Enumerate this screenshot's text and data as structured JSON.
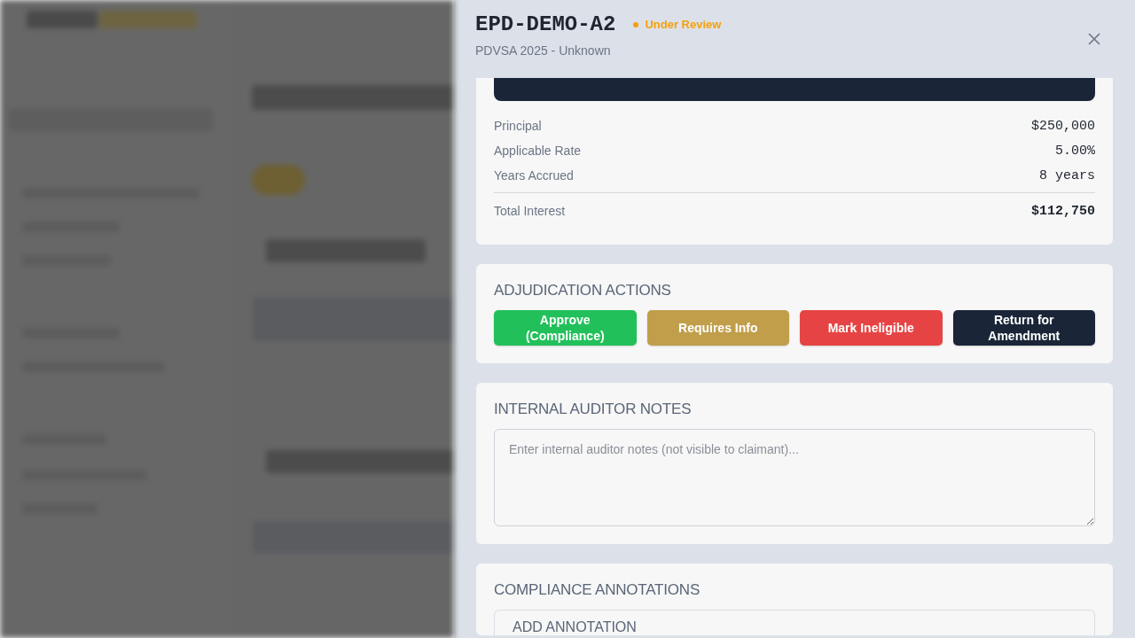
{
  "drawer": {
    "title": "EPD-DEMO-A2",
    "status": {
      "label": "Under Review",
      "kind": "review"
    },
    "subtitle": "PDVSA 2025 - Unknown"
  },
  "interest": {
    "rows": [
      {
        "label": "Principal",
        "value": "$250,000"
      },
      {
        "label": "Applicable Rate",
        "value": "5.00%"
      },
      {
        "label": "Years Accrued",
        "value": "8 years"
      }
    ],
    "total": {
      "label": "Total Interest",
      "value": "$112,750"
    }
  },
  "actions": {
    "heading": "ADJUDICATION ACTIONS",
    "buttons": [
      {
        "label": "Approve (Compliance)",
        "kind": "approve"
      },
      {
        "label": "Requires Info",
        "kind": "info"
      },
      {
        "label": "Mark Ineligible",
        "kind": "reject"
      },
      {
        "label": "Return for Amendment",
        "kind": "return"
      }
    ]
  },
  "notes": {
    "heading": "INTERNAL AUDITOR NOTES",
    "placeholder": "Enter internal auditor notes (not visible to claimant)..."
  },
  "annotations": {
    "heading": "COMPLIANCE ANNOTATIONS",
    "subheading": "ADD ANNOTATION"
  }
}
